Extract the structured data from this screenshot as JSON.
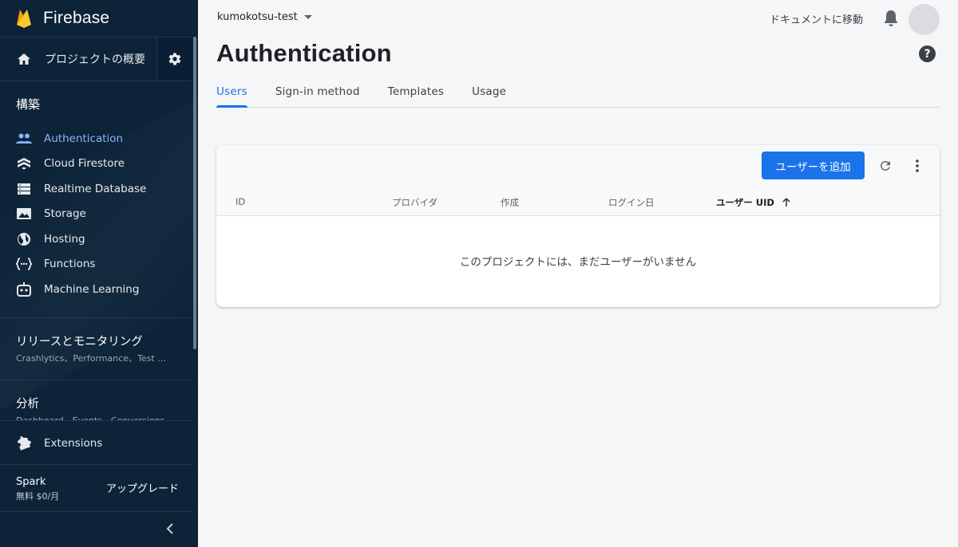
{
  "brand": {
    "name": "Firebase"
  },
  "sidebar": {
    "overview_label": "プロジェクトの概要",
    "build_heading": "構築",
    "items": [
      {
        "label": "Authentication",
        "icon": "people-icon",
        "active": true
      },
      {
        "label": "Cloud Firestore",
        "icon": "firestore-icon"
      },
      {
        "label": "Realtime Database",
        "icon": "database-icon"
      },
      {
        "label": "Storage",
        "icon": "storage-icon"
      },
      {
        "label": "Hosting",
        "icon": "globe-icon"
      },
      {
        "label": "Functions",
        "icon": "functions-icon"
      },
      {
        "label": "Machine Learning",
        "icon": "robot-icon"
      }
    ],
    "release_title": "リリースとモニタリング",
    "release_sub": "Crashlytics、Performance、Test …",
    "analytics_title": "分析",
    "analytics_sub": "Dashboard、Events、Conversions、…",
    "extensions_label": "Extensions",
    "plan_name": "Spark",
    "plan_price": "無料 $0/月",
    "upgrade_label": "アップグレード"
  },
  "header": {
    "project": "kumokotsu-test",
    "docs_link": "ドキュメントに移動",
    "page_title": "Authentication"
  },
  "tabs": [
    {
      "label": "Users",
      "active": true
    },
    {
      "label": "Sign-in method"
    },
    {
      "label": "Templates"
    },
    {
      "label": "Usage"
    }
  ],
  "table": {
    "add_user_label": "ユーザーを追加",
    "columns": [
      "ID",
      "プロバイダ",
      "作成",
      "ログイン日",
      "ユーザー UID"
    ],
    "sorted_column": "ユーザー UID",
    "empty_message": "このプロジェクトには、まだユーザーがいません"
  },
  "colors": {
    "sidebar_bg": "#0c2338",
    "accent": "#1a73e8",
    "active_nav": "#8ab4f8",
    "page_bg": "#f5f6f8"
  }
}
